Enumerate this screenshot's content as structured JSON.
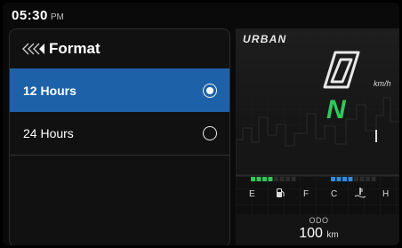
{
  "status": {
    "time": "05:30",
    "meridiem": "PM"
  },
  "panel": {
    "title": "Format",
    "options": [
      {
        "label": "12 Hours",
        "selected": true
      },
      {
        "label": "24 Hours",
        "selected": false
      }
    ]
  },
  "dashboard": {
    "mode": "URBAN",
    "speed_unit": "km/h",
    "gear": "N",
    "fuel_gauge": {
      "empty_label": "E",
      "full_label": "F",
      "level": 0.5
    },
    "temp_gauge": {
      "cold_label": "C",
      "hot_label": "H",
      "level": 0.5
    },
    "odometer": {
      "label": "ODO",
      "value": "100",
      "unit": "km"
    }
  },
  "colors": {
    "selected_bg": "#1d62a8",
    "fuel_green": "#2fc95a",
    "temp_blue": "#2e8be0"
  }
}
